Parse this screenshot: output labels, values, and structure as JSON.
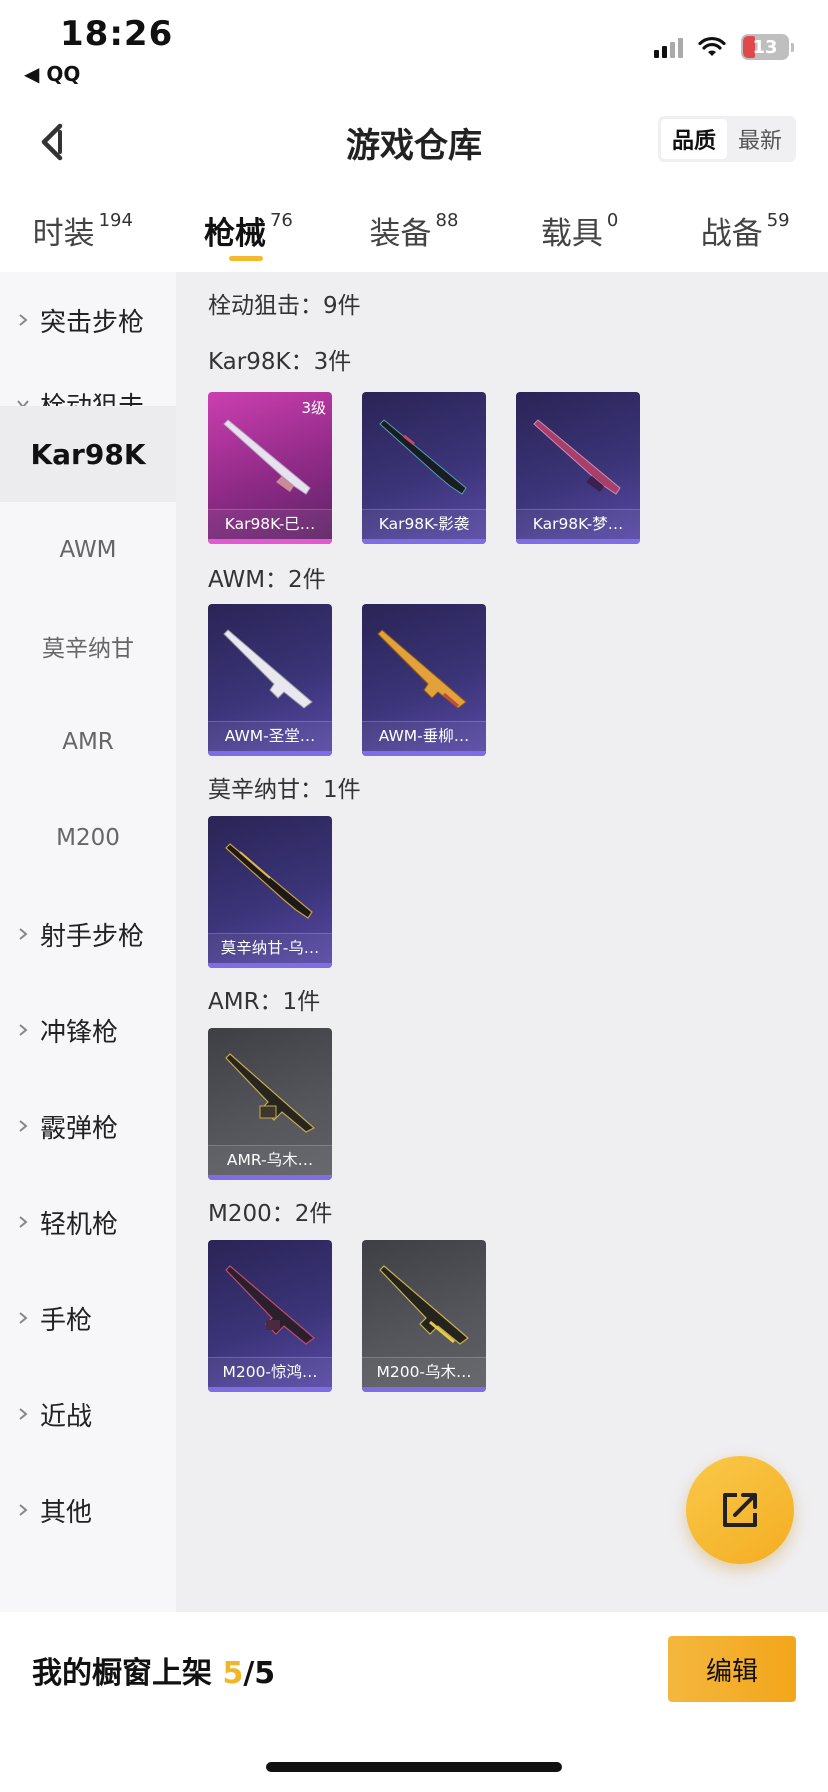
{
  "status_bar": {
    "time": "18:26",
    "back_app": "◀ QQ",
    "battery": "13"
  },
  "header": {
    "title": "游戏仓库",
    "sort_options": [
      "品质",
      "最新"
    ],
    "active_sort": "品质"
  },
  "tabs": [
    {
      "label": "时装",
      "count": "194",
      "active": false
    },
    {
      "label": "枪械",
      "count": "76",
      "active": true
    },
    {
      "label": "装备",
      "count": "88",
      "active": false
    },
    {
      "label": "载具",
      "count": "0",
      "active": false
    },
    {
      "label": "战备",
      "count": "59",
      "active": false
    }
  ],
  "sidebar": {
    "items": [
      {
        "label": "突击步枪",
        "type": "category",
        "expanded": false
      },
      {
        "label": "栓动狙击",
        "type": "category",
        "expanded": true
      },
      {
        "label": "Kar98K",
        "type": "sub",
        "active": true
      },
      {
        "label": "AWM",
        "type": "sub",
        "active": false
      },
      {
        "label": "莫辛纳甘",
        "type": "sub",
        "active": false
      },
      {
        "label": "AMR",
        "type": "sub",
        "active": false
      },
      {
        "label": "M200",
        "type": "sub",
        "active": false
      },
      {
        "label": "射手步枪",
        "type": "category",
        "expanded": false
      },
      {
        "label": "冲锋枪",
        "type": "category",
        "expanded": false
      },
      {
        "label": "霰弹枪",
        "type": "category",
        "expanded": false
      },
      {
        "label": "轻机枪",
        "type": "category",
        "expanded": false
      },
      {
        "label": "手枪",
        "type": "category",
        "expanded": false
      },
      {
        "label": "近战",
        "type": "category",
        "expanded": false
      },
      {
        "label": "其他",
        "type": "category",
        "expanded": false
      }
    ]
  },
  "content": {
    "section_title": "栓动狙击：9件",
    "groups": [
      {
        "title": "Kar98K：3件",
        "items": [
          {
            "name": "Kar98K-巳…",
            "rarity": "pink",
            "level": "3级"
          },
          {
            "name": "Kar98K-影袭",
            "rarity": "purple",
            "level": ""
          },
          {
            "name": "Kar98K-梦…",
            "rarity": "purple",
            "level": ""
          }
        ]
      },
      {
        "title": "AWM：2件",
        "items": [
          {
            "name": "AWM-圣堂…",
            "rarity": "purple",
            "level": ""
          },
          {
            "name": "AWM-垂柳…",
            "rarity": "purple",
            "level": ""
          }
        ]
      },
      {
        "title": "莫辛纳甘：1件",
        "items": [
          {
            "name": "莫辛纳甘-乌…",
            "rarity": "purple",
            "level": ""
          }
        ]
      },
      {
        "title": "AMR：1件",
        "items": [
          {
            "name": "AMR-乌木…",
            "rarity": "grey",
            "level": ""
          }
        ]
      },
      {
        "title": "M200：2件",
        "items": [
          {
            "name": "M200-惊鸿…",
            "rarity": "purple",
            "level": ""
          },
          {
            "name": "M200-乌木…",
            "rarity": "grey",
            "level": ""
          }
        ]
      }
    ]
  },
  "fab": {
    "icon": "share-external-icon"
  },
  "showcase": {
    "label": "我的橱窗上架 ",
    "current": "5",
    "total": "/5",
    "edit_label": "编辑"
  },
  "colors": {
    "accent": "#f4b73e",
    "pink_rarity": "#cc3fb0",
    "purple_rarity": "#3b3478",
    "grey_rarity": "#56575d"
  }
}
